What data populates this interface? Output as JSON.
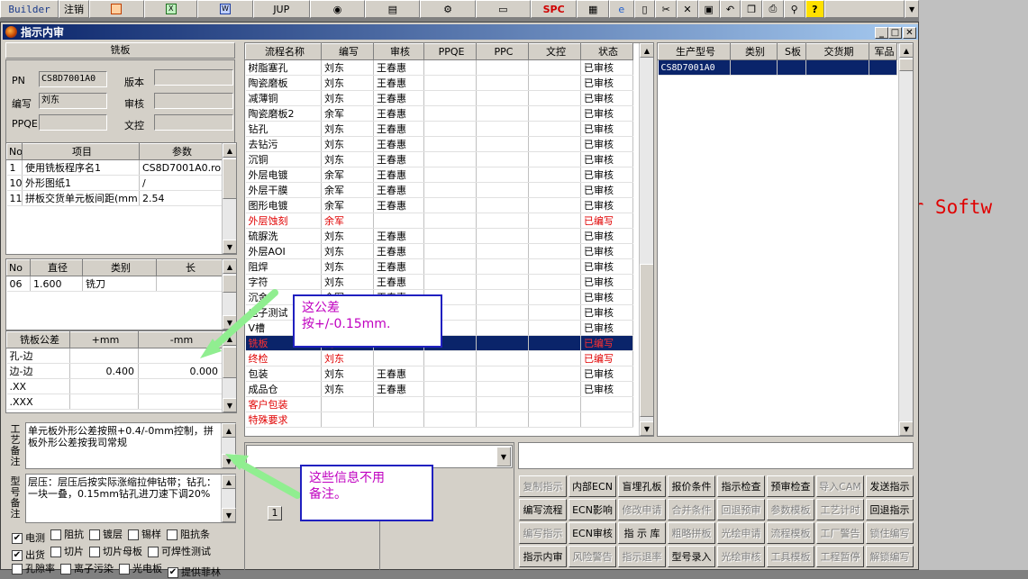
{
  "toolbar": {
    "builder": "Builder",
    "logout": "注销",
    "jup": "JUP",
    "spc": "SPC"
  },
  "background_text": "er Softw",
  "window": {
    "title": "指示内审"
  },
  "board": {
    "header": "铣板",
    "pn_label": "PN",
    "pn_value": "CS8D7001A0",
    "version_label": "版本",
    "version_value": "",
    "editor_label": "编写",
    "editor_value": "刘东",
    "reviewer_label": "审核",
    "reviewer_value": "",
    "ppqe_label": "PPQE",
    "ppqe_value": "",
    "doc_label": "文控",
    "doc_value": ""
  },
  "params": {
    "headers": [
      "No",
      "项目",
      "参数"
    ],
    "rows": [
      [
        "1",
        "使用铣板程序名1",
        "CS8D7001A0.rou"
      ],
      [
        "10",
        "外形图纸1",
        "/"
      ],
      [
        "11",
        "拼板交货单元板间距(mm",
        "2.54"
      ]
    ]
  },
  "tools": {
    "headers": [
      "No",
      "直径",
      "类别",
      "长"
    ],
    "rows": [
      [
        "06",
        "1.600",
        "铣刀",
        ""
      ]
    ]
  },
  "tolerance": {
    "headers": [
      "铣板公差",
      "+mm",
      "-mm"
    ],
    "rows": [
      [
        "孔-边",
        "",
        ""
      ],
      [
        "边-边",
        "0.400",
        "0.000"
      ],
      [
        ".XX",
        "",
        ""
      ],
      [
        ".XXX",
        "",
        ""
      ]
    ]
  },
  "process_note": {
    "label": "工艺备注",
    "text": "单元板外形公差按照+0.4/-0mm控制，拼板外形公差按我司常规"
  },
  "model_note": {
    "label": "型号备注",
    "text": "层压：层压后按实际涨缩拉伸钻带；钻孔：一块一叠，0.15mm钻孔进刀速下调20%"
  },
  "checks": [
    {
      "label": "电测",
      "checked": true
    },
    {
      "label": "阻抗",
      "checked": false
    },
    {
      "label": "镀层",
      "checked": false
    },
    {
      "label": "锡样",
      "checked": false
    },
    {
      "label": "阻抗条",
      "checked": false
    },
    {
      "label": "出货",
      "checked": true
    },
    {
      "label": "切片",
      "checked": false
    },
    {
      "label": "切片母板",
      "checked": false
    },
    {
      "label": "可焊性测试",
      "checked": false
    },
    {
      "label": "孔隙率",
      "checked": false
    },
    {
      "label": "离子污染",
      "checked": false
    },
    {
      "label": "光电板",
      "checked": false
    },
    {
      "label": "提供菲林",
      "checked": true
    }
  ],
  "flow": {
    "headers": [
      "流程名称",
      "编写",
      "审核",
      "PPQE",
      "PPC",
      "文控",
      "状态"
    ],
    "rows": [
      {
        "cells": [
          "树脂塞孔",
          "刘东",
          "王春惠",
          "",
          "",
          "",
          "已审核"
        ],
        "red": false,
        "selected": false
      },
      {
        "cells": [
          "陶瓷磨板",
          "刘东",
          "王春惠",
          "",
          "",
          "",
          "已审核"
        ],
        "red": false,
        "selected": false
      },
      {
        "cells": [
          "减薄铜",
          "刘东",
          "王春惠",
          "",
          "",
          "",
          "已审核"
        ],
        "red": false,
        "selected": false
      },
      {
        "cells": [
          "陶瓷磨板2",
          "余军",
          "王春惠",
          "",
          "",
          "",
          "已审核"
        ],
        "red": false,
        "selected": false
      },
      {
        "cells": [
          "钻孔",
          "刘东",
          "王春惠",
          "",
          "",
          "",
          "已审核"
        ],
        "red": false,
        "selected": false
      },
      {
        "cells": [
          "去钻污",
          "刘东",
          "王春惠",
          "",
          "",
          "",
          "已审核"
        ],
        "red": false,
        "selected": false
      },
      {
        "cells": [
          "沉铜",
          "刘东",
          "王春惠",
          "",
          "",
          "",
          "已审核"
        ],
        "red": false,
        "selected": false
      },
      {
        "cells": [
          "外层电镀",
          "余军",
          "王春惠",
          "",
          "",
          "",
          "已审核"
        ],
        "red": false,
        "selected": false
      },
      {
        "cells": [
          "外层干膜",
          "余军",
          "王春惠",
          "",
          "",
          "",
          "已审核"
        ],
        "red": false,
        "selected": false
      },
      {
        "cells": [
          "图形电镀",
          "余军",
          "王春惠",
          "",
          "",
          "",
          "已审核"
        ],
        "red": false,
        "selected": false
      },
      {
        "cells": [
          "外层蚀刻",
          "余军",
          "",
          "",
          "",
          "",
          "已编写"
        ],
        "red": true,
        "selected": false
      },
      {
        "cells": [
          "硫脲洗",
          "刘东",
          "王春惠",
          "",
          "",
          "",
          "已审核"
        ],
        "red": false,
        "selected": false
      },
      {
        "cells": [
          "外层AOI",
          "刘东",
          "王春惠",
          "",
          "",
          "",
          "已审核"
        ],
        "red": false,
        "selected": false
      },
      {
        "cells": [
          "阻焊",
          "刘东",
          "王春惠",
          "",
          "",
          "",
          "已审核"
        ],
        "red": false,
        "selected": false
      },
      {
        "cells": [
          "字符",
          "刘东",
          "王春惠",
          "",
          "",
          "",
          "已审核"
        ],
        "red": false,
        "selected": false
      },
      {
        "cells": [
          "沉金",
          "余军",
          "王春惠",
          "",
          "",
          "",
          "已审核"
        ],
        "red": false,
        "selected": false
      },
      {
        "cells": [
          "电子测试",
          "刘东",
          "王春惠",
          "",
          "",
          "",
          "已审核"
        ],
        "red": false,
        "selected": false
      },
      {
        "cells": [
          "V槽",
          "",
          "",
          "",
          "",
          "",
          "已审核"
        ],
        "red": false,
        "selected": false
      },
      {
        "cells": [
          "铣板",
          "刘东",
          "",
          "",
          "",
          "",
          "已编写"
        ],
        "red": true,
        "selected": true
      },
      {
        "cells": [
          "终检",
          "刘东",
          "",
          "",
          "",
          "",
          "已编写"
        ],
        "red": true,
        "selected": false
      },
      {
        "cells": [
          "包装",
          "刘东",
          "王春惠",
          "",
          "",
          "",
          "已审核"
        ],
        "red": false,
        "selected": false
      },
      {
        "cells": [
          "成品仓",
          "刘东",
          "王春惠",
          "",
          "",
          "",
          "已审核"
        ],
        "red": false,
        "selected": false
      },
      {
        "cells": [
          "客户包装",
          "",
          "",
          "",
          "",
          "",
          ""
        ],
        "red": true,
        "selected": false
      },
      {
        "cells": [
          "特殊要求",
          "",
          "",
          "",
          "",
          "",
          ""
        ],
        "red": true,
        "selected": false
      }
    ]
  },
  "models": {
    "headers": [
      "生产型号",
      "类别",
      "S板",
      "交货期",
      "军品"
    ],
    "rows": [
      [
        "CS8D7001A0",
        "",
        "",
        "",
        ""
      ]
    ]
  },
  "page_label": "1",
  "buttons": [
    {
      "label": "复制指示",
      "enabled": false
    },
    {
      "label": "内部ECN",
      "enabled": true
    },
    {
      "label": "盲埋孔板",
      "enabled": true
    },
    {
      "label": "报价条件",
      "enabled": true
    },
    {
      "label": "指示检查",
      "enabled": true
    },
    {
      "label": "预审检查",
      "enabled": true
    },
    {
      "label": "导入CAM",
      "enabled": false
    },
    {
      "label": "发送指示",
      "enabled": true
    },
    {
      "label": "编写流程",
      "enabled": true
    },
    {
      "label": "ECN影响",
      "enabled": true
    },
    {
      "label": "修改申请",
      "enabled": false
    },
    {
      "label": "合并条件",
      "enabled": false
    },
    {
      "label": "回退预审",
      "enabled": false
    },
    {
      "label": "参数模板",
      "enabled": false
    },
    {
      "label": "工艺计时",
      "enabled": false
    },
    {
      "label": "回退指示",
      "enabled": true
    },
    {
      "label": "编写指示",
      "enabled": false
    },
    {
      "label": "ECN审核",
      "enabled": true
    },
    {
      "label": "指 示 库",
      "enabled": true
    },
    {
      "label": "粗略拼板",
      "enabled": false
    },
    {
      "label": "光绘申请",
      "enabled": false
    },
    {
      "label": "流程模板",
      "enabled": false
    },
    {
      "label": "工厂警告",
      "enabled": false
    },
    {
      "label": "锁住编写",
      "enabled": false
    },
    {
      "label": "指示内审",
      "enabled": true
    },
    {
      "label": "风险警告",
      "enabled": false
    },
    {
      "label": "指示退率",
      "enabled": false
    },
    {
      "label": "型号录入",
      "enabled": true
    },
    {
      "label": "光绘审核",
      "enabled": false
    },
    {
      "label": "工具模板",
      "enabled": false
    },
    {
      "label": "工程暂停",
      "enabled": false
    },
    {
      "label": "解锁编写",
      "enabled": false
    }
  ],
  "callouts": {
    "tolerance": [
      "这公差",
      "按+/-0.15mm."
    ],
    "notes": [
      "这些信息不用",
      "备注。"
    ]
  }
}
